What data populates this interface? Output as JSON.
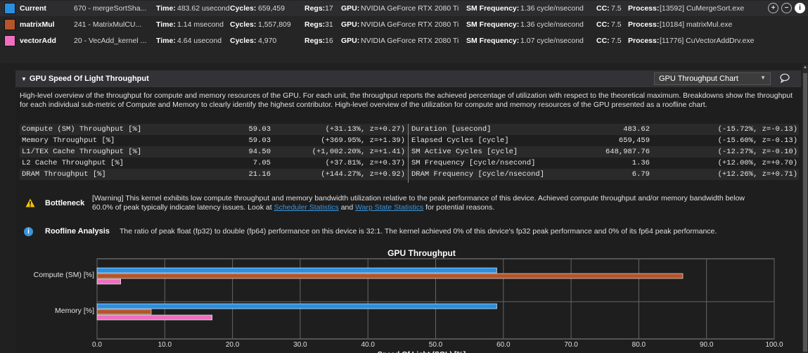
{
  "results": [
    {
      "name": "Current",
      "color": "#2b8fe0",
      "kernel": "670 - mergeSortSha...",
      "time_label": "Time:",
      "time": "483.62 usecond",
      "cycles_label": "Cycles:",
      "cycles": "659,459",
      "regs_label": "Regs:",
      "regs": "17",
      "gpu_label": "GPU:",
      "gpu": "NVIDIA GeForce RTX 2080 Ti",
      "smf_label": "SM Frequency:",
      "smf": "1.36 cycle/nsecond",
      "cc_label": "CC:",
      "cc": "7.5",
      "proc_label": "Process:",
      "proc": "[13592] CuMergeSort.exe"
    },
    {
      "name": "matrixMul",
      "color": "#b5552a",
      "kernel": "241 - MatrixMulCU...",
      "time_label": "Time:",
      "time": "1.14 msecond",
      "cycles_label": "Cycles:",
      "cycles": "1,557,809",
      "regs_label": "Regs:",
      "regs": "31",
      "gpu_label": "GPU:",
      "gpu": "NVIDIA GeForce RTX 2080 Ti",
      "smf_label": "SM Frequency:",
      "smf": "1.36 cycle/nsecond",
      "cc_label": "CC:",
      "cc": "7.5",
      "proc_label": "Process:",
      "proc": "[10184] matrixMul.exe"
    },
    {
      "name": "vectorAdd",
      "color": "#f06ec0",
      "kernel": "20 - VecAdd_kernel ...",
      "time_label": "Time:",
      "time": "4.64 usecond",
      "cycles_label": "Cycles:",
      "cycles": "4,970",
      "regs_label": "Regs:",
      "regs": "16",
      "gpu_label": "GPU:",
      "gpu": "NVIDIA GeForce RTX 2080 Ti",
      "smf_label": "SM Frequency:",
      "smf": "1.07 cycle/nsecond",
      "cc_label": "CC:",
      "cc": "7.5",
      "proc_label": "Process:",
      "proc": "[11776] CuVectorAddDrv.exe"
    }
  ],
  "header_icons": [
    {
      "name": "add-baseline-icon",
      "glyph": "+"
    },
    {
      "name": "remove-baseline-icon",
      "glyph": "−"
    },
    {
      "name": "info-icon",
      "glyph": "i"
    }
  ],
  "section": {
    "title": "GPU Speed Of Light Throughput",
    "dropdown": "GPU Throughput Chart",
    "description": "High-level overview of the throughput for compute and memory resources of the GPU. For each unit, the throughput reports the achieved percentage of utilization with respect to the theoretical maximum. Breakdowns show the throughput for each individual sub-metric of Compute and Memory to clearly identify the highest contributor. High-level overview of the utilization for compute and memory resources of the GPU presented as a roofline chart."
  },
  "metrics": [
    {
      "name": "Compute (SM) Throughput [%]",
      "value": "59.03",
      "delta": "(+31.13%, z=+0.27)",
      "name2": "Duration [usecond]",
      "value2": "483.62",
      "delta2": "(-15.72%, z=-0.13)"
    },
    {
      "name": "Memory Throughput [%]",
      "value": "59.03",
      "delta": "(+369.95%, z=+1.39)",
      "name2": "Elapsed Cycles [cycle]",
      "value2": "659,459",
      "delta2": "(-15.60%, z=-0.13)"
    },
    {
      "name": "L1/TEX Cache Throughput [%]",
      "value": "94.50",
      "delta": "(+1,002.20%, z=+1.41)",
      "name2": "SM Active Cycles [cycle]",
      "value2": "648,987.76",
      "delta2": "(-12.27%, z=-0.10)"
    },
    {
      "name": "L2 Cache Throughput [%]",
      "value": "7.05",
      "delta": "(+37.81%, z=+0.37)",
      "name2": "SM Frequency [cycle/nsecond]",
      "value2": "1.36",
      "delta2": "(+12.00%, z=+0.70)"
    },
    {
      "name": "DRAM Throughput [%]",
      "value": "21.16",
      "delta": "(+144.27%, z=+0.92)",
      "name2": "DRAM Frequency [cycle/nsecond]",
      "value2": "6.79",
      "delta2": "(+12.26%, z=+0.71)"
    }
  ],
  "bottleneck": {
    "label": "Bottleneck",
    "text_before": "[Warning] This kernel exhibits low compute throughput and memory bandwidth utilization relative to the peak performance of this device. Achieved compute throughput and/or memory bandwidth below 60.0% of peak typically indicate latency issues. Look at ",
    "link1": "Scheduler Statistics",
    "text_mid": " and ",
    "link2": "Warp State Statistics",
    "text_after": " for potential reasons."
  },
  "roofline": {
    "label": "Roofline Analysis",
    "text": "The ratio of peak float (fp32) to double (fp64) performance on this device is 32:1. The kernel achieved 0% of this device's fp32 peak performance and 0% of its fp64 peak performance."
  },
  "chart_data": {
    "type": "bar",
    "orientation": "horizontal",
    "title": "GPU Throughput",
    "xlabel": "Speed Of Light (SOL) [%]",
    "ylabel": "",
    "categories": [
      "Compute (SM) [%]",
      "Memory [%]"
    ],
    "series": [
      {
        "name": "Current",
        "color": "#2b8fe0",
        "values": [
          59.03,
          59.03
        ]
      },
      {
        "name": "matrixMul",
        "color": "#b5552a",
        "values": [
          86.5,
          8.0
        ]
      },
      {
        "name": "vectorAdd",
        "color": "#f06ec0",
        "values": [
          3.5,
          17.0
        ]
      }
    ],
    "xlim": [
      0,
      100
    ],
    "xticks": [
      "0.0",
      "10.0",
      "20.0",
      "30.0",
      "40.0",
      "50.0",
      "60.0",
      "70.0",
      "80.0",
      "90.0",
      "100.0"
    ],
    "grid": true
  }
}
